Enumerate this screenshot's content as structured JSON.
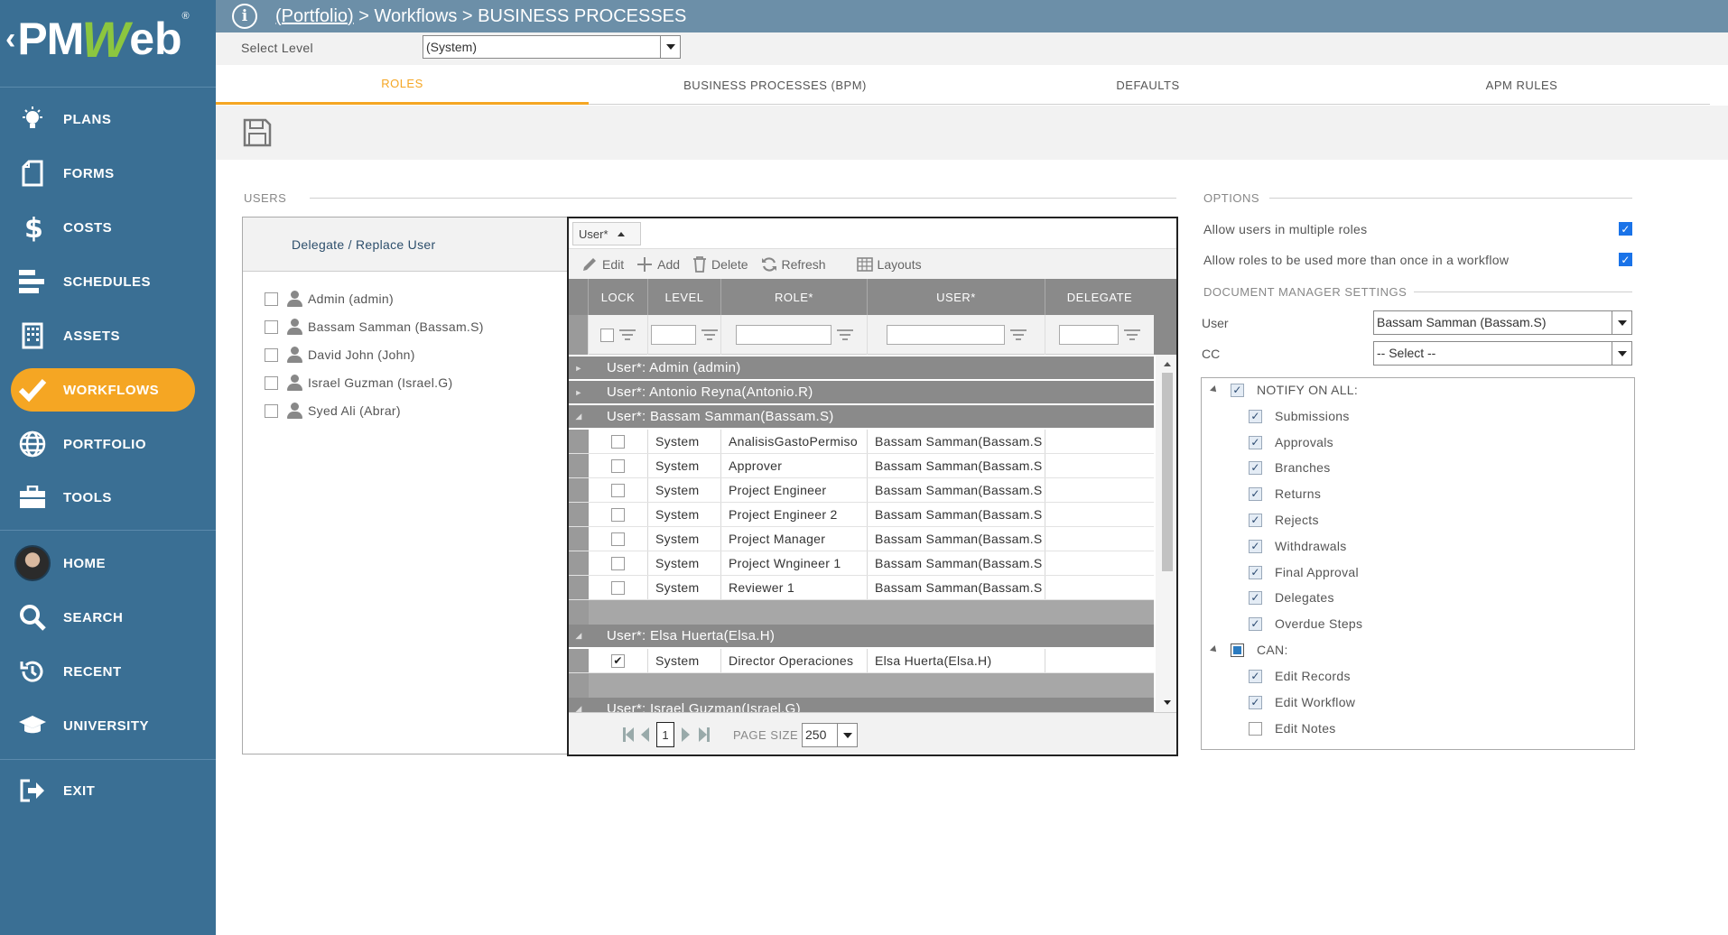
{
  "app": {
    "logo_text_pm": "PM",
    "logo_text_w": "W",
    "logo_text_eb": "eb",
    "logo_reg": "®",
    "back_glyph": "‹"
  },
  "sidebar": {
    "items": [
      {
        "label": "PLANS",
        "icon": "lightbulb-icon"
      },
      {
        "label": "FORMS",
        "icon": "document-icon"
      },
      {
        "label": "COSTS",
        "icon": "dollar-icon"
      },
      {
        "label": "SCHEDULES",
        "icon": "gantt-icon"
      },
      {
        "label": "ASSETS",
        "icon": "building-icon"
      },
      {
        "label": "WORKFLOWS",
        "icon": "checkmark-icon",
        "active": true
      },
      {
        "label": "PORTFOLIO",
        "icon": "globe-icon"
      },
      {
        "label": "TOOLS",
        "icon": "toolbox-icon"
      },
      {
        "label": "HOME",
        "icon": "avatar-icon"
      },
      {
        "label": "SEARCH",
        "icon": "search-icon"
      },
      {
        "label": "RECENT",
        "icon": "history-icon"
      },
      {
        "label": "UNIVERSITY",
        "icon": "graduation-cap-icon"
      },
      {
        "label": "EXIT",
        "icon": "exit-icon"
      }
    ]
  },
  "topbar": {
    "info_glyph": "i",
    "crumb_link": "(Portfolio)",
    "crumb_rest": " > Workflows > BUSINESS PROCESSES"
  },
  "level": {
    "label": "Select Level",
    "value": "(System)"
  },
  "tabs": [
    {
      "label": "ROLES",
      "active": true
    },
    {
      "label": "BUSINESS PROCESSES (BPM)"
    },
    {
      "label": "DEFAULTS"
    },
    {
      "label": "APM RULES"
    }
  ],
  "users": {
    "section_title": "USERS",
    "delegate_label": "Delegate / Replace User",
    "list": [
      "Admin (admin)",
      "Bassam Samman (Bassam.S)",
      "David John (John)",
      "Israel Guzman (Israel.G)",
      "Syed Ali (Abrar)"
    ]
  },
  "grid": {
    "group_chip": "User*",
    "toolbar": {
      "edit": "Edit",
      "add": "Add",
      "delete": "Delete",
      "refresh": "Refresh",
      "layouts": "Layouts"
    },
    "columns": [
      "LOCK",
      "LEVEL",
      "ROLE*",
      "USER*",
      "DELEGATE"
    ],
    "groups": [
      {
        "title": "User*: Admin (admin)",
        "expanded": false
      },
      {
        "title": "User*: Antonio Reyna(Antonio.R)",
        "expanded": false
      },
      {
        "title": "User*: Bassam Samman(Bassam.S)",
        "expanded": true,
        "rows": [
          {
            "lock": false,
            "level": "System",
            "role": "AnalisisGastoPermiso",
            "user": "Bassam Samman(Bassam.S",
            "delegate": ""
          },
          {
            "lock": false,
            "level": "System",
            "role": "Approver",
            "user": "Bassam Samman(Bassam.S",
            "delegate": ""
          },
          {
            "lock": false,
            "level": "System",
            "role": "Project Engineer",
            "user": "Bassam Samman(Bassam.S",
            "delegate": ""
          },
          {
            "lock": false,
            "level": "System",
            "role": "Project Engineer 2",
            "user": "Bassam Samman(Bassam.S",
            "delegate": ""
          },
          {
            "lock": false,
            "level": "System",
            "role": "Project Manager",
            "user": "Bassam Samman(Bassam.S",
            "delegate": ""
          },
          {
            "lock": false,
            "level": "System",
            "role": "Project Wngineer 1",
            "user": "Bassam Samman(Bassam.S",
            "delegate": ""
          },
          {
            "lock": false,
            "level": "System",
            "role": "Reviewer 1",
            "user": "Bassam Samman(Bassam.S",
            "delegate": ""
          }
        ]
      },
      {
        "title": "User*: Elsa Huerta(Elsa.H)",
        "expanded": true,
        "rows": [
          {
            "lock": true,
            "level": "System",
            "role": "Director Operaciones",
            "user": "Elsa Huerta(Elsa.H)",
            "delegate": ""
          }
        ]
      },
      {
        "title": "User*: Israel Guzman(Israel.G)",
        "expanded": true
      }
    ],
    "pager": {
      "page": "1",
      "page_size_label": "PAGE SIZE",
      "page_size": "250"
    }
  },
  "options": {
    "section_title": "OPTIONS",
    "multi_roles_label": "Allow users in multiple roles",
    "multi_roles_checked": true,
    "roles_more_than_once_label": "Allow roles to be used more than once in a workflow",
    "roles_more_than_once_checked": true,
    "dm_title": "DOCUMENT MANAGER SETTINGS",
    "user_label": "User",
    "user_value": "Bassam Samman (Bassam.S)",
    "cc_label": "CC",
    "cc_value": "-- Select --",
    "notify_label": "NOTIFY ON ALL:",
    "notify_items": [
      "Submissions",
      "Approvals",
      "Branches",
      "Returns",
      "Rejects",
      "Withdrawals",
      "Final Approval",
      "Delegates",
      "Overdue Steps"
    ],
    "can_label": "CAN:",
    "can_items": [
      {
        "label": "Edit Records",
        "checked": true
      },
      {
        "label": "Edit Workflow",
        "checked": true
      },
      {
        "label": "Edit Notes",
        "checked": false
      }
    ]
  },
  "colors": {
    "sidebar": "#3a6f94",
    "accent": "#f5a623",
    "topbar": "#6c8fa8",
    "grid_header": "#8a8a8a"
  }
}
